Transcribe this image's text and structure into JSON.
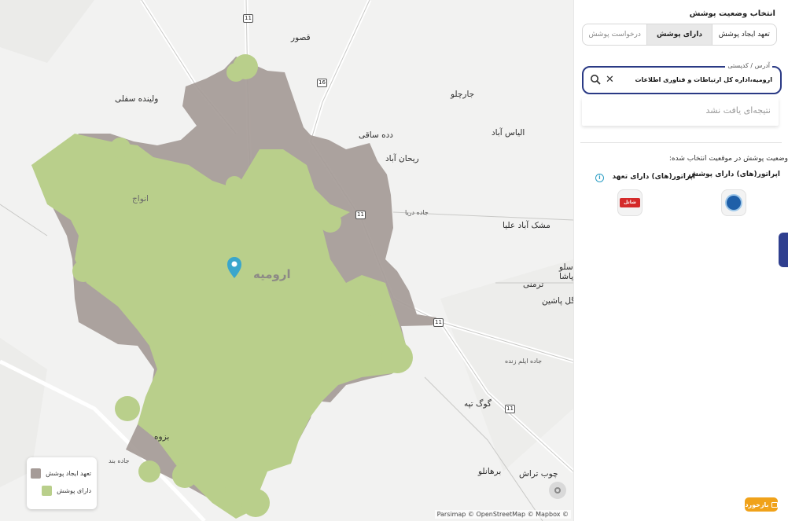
{
  "map": {
    "labels": [
      {
        "name": "qasur",
        "text": "قصور"
      },
      {
        "name": "jarchelu",
        "text": "جارچلو"
      },
      {
        "name": "valindeh-sofla",
        "text": "ولینده سفلی"
      },
      {
        "name": "ilias-abad",
        "text": "الیاس آباد"
      },
      {
        "name": "dadeh-saqi",
        "text": "دده ساقی"
      },
      {
        "name": "reyhan-abad",
        "text": "ریحان آباد"
      },
      {
        "name": "meshkabad-olya",
        "text": "مشک آباد علیا"
      },
      {
        "name": "tarmani",
        "text": "ترمنی"
      },
      {
        "name": "pasha",
        "text": "پاشا"
      },
      {
        "name": "selu",
        "text": "سلو"
      },
      {
        "name": "gol-pashin",
        "text": "گل پاشین"
      },
      {
        "name": "gog-tappeh",
        "text": "گوگ تپه"
      },
      {
        "name": "borhanlu",
        "text": "برهانلو"
      },
      {
        "name": "chub-tarash",
        "text": "چوب تراش"
      },
      {
        "name": "barzeh",
        "text": "بزوه"
      },
      {
        "name": "anvaj",
        "text": "انواج"
      }
    ],
    "city_label": "ارومیه",
    "road_shields": [
      "11",
      "16",
      "11",
      "11",
      "11"
    ],
    "road_labels": [
      "جاده دریا",
      "جاده ایلم زنده",
      "جاده بند"
    ],
    "legend": [
      {
        "label": "تعهد ایجاد پوشش",
        "color": "#a59b97"
      },
      {
        "label": "دارای پوشش",
        "color": "#b9cf8b"
      }
    ],
    "attribution": "Parsimap © OpenStreetMap © Mapbox ©",
    "colors": {
      "committed": "#a59b97",
      "covered": "#b9cf8b",
      "pin": "#3aa6cc",
      "background": "#f2f2f1"
    }
  },
  "panel": {
    "title": "انتخاب وضعیت پوشش",
    "tabs": [
      {
        "label": "تعهد ایجاد پوشش",
        "active": false
      },
      {
        "label": "دارای پوشش",
        "active": true
      },
      {
        "label": "درخواست پوشش",
        "active": false
      }
    ],
    "search": {
      "legend": "آدرس / کدپستی",
      "value": "ارومیه،اداره کل ارتباطات و فناوری اطلاعات",
      "clear_icon": "close-icon",
      "search_icon": "search-icon"
    },
    "no_result": "نتیجه‌ای یافت نشد",
    "status_title": "وضعیت پوشش در موقعیت انتخاب شده:",
    "columns": {
      "covered": "اپراتور(های) دارای پوشش",
      "committed": "اپراتور(های) دارای تعهد"
    },
    "operators": {
      "covered_logo": "operator-logo-icon",
      "committed_logo_text": "شاتل"
    }
  },
  "feedback": {
    "label": "بازخورد"
  }
}
